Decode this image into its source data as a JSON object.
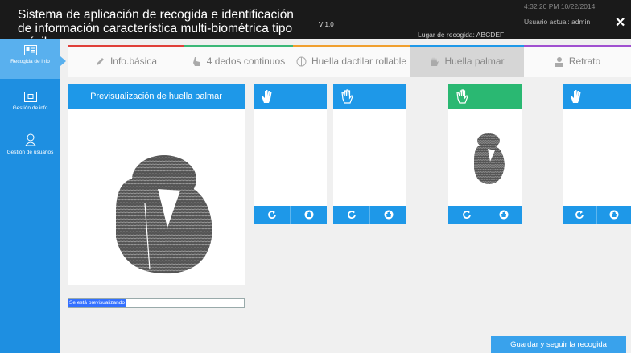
{
  "header": {
    "title": "Sistema de aplicación de recogida e identificación de información característica multi-biométrica tipo móvil",
    "version": "V 1.0",
    "location": "Lugar de recogida: ABCDEF",
    "time": "4:32:20 PM 10/22/2014",
    "user": "Usuario actual: admin",
    "close": "✕"
  },
  "sidebar": {
    "items": [
      {
        "label": "Recogida de info",
        "icon": "id-card-icon"
      },
      {
        "label": "Gestión de info",
        "icon": "document-icon"
      },
      {
        "label": "Gestión de usuarios",
        "icon": "user-icon"
      }
    ]
  },
  "tabs": [
    {
      "label": "Info.básica",
      "icon": "pencil-icon",
      "color": "#e0403a"
    },
    {
      "label": "4 dedos continuos",
      "icon": "finger-icon",
      "color": "#3cb878"
    },
    {
      "label": "Huella dactilar rollable",
      "icon": "rolled-print-icon",
      "color": "#f0a030"
    },
    {
      "label": "Huella palmar",
      "icon": "palm-icon",
      "color": "#1e98e8"
    },
    {
      "label": "Retrato",
      "icon": "portrait-icon",
      "color": "#a050d0"
    }
  ],
  "preview": {
    "title": "Previsualización de huella palmar",
    "status": "Se está previsualizando"
  },
  "cards": [
    {
      "icon": "left-hand-icon",
      "state": "empty"
    },
    {
      "icon": "right-hand-icon",
      "state": "empty"
    },
    {
      "icon": "right-hand-icon",
      "state": "captured"
    },
    {
      "icon": "left-hand-icon",
      "state": "empty"
    }
  ],
  "actions": {
    "save_label": "Guardar y seguir la recogida"
  },
  "colors": {
    "sidebar": "#1e8fe1",
    "card_header": "#1e98e8",
    "card_active": "#2ab872",
    "header_bg": "#1a1a1a"
  }
}
